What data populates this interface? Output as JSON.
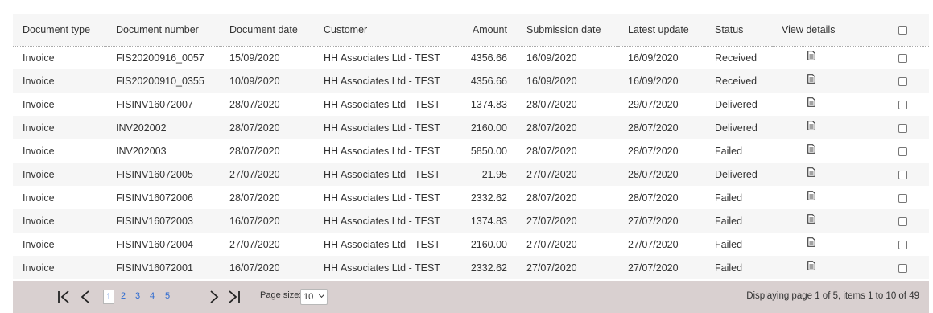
{
  "columns": [
    {
      "key": "type",
      "label": "Document type"
    },
    {
      "key": "number",
      "label": "Document number"
    },
    {
      "key": "date",
      "label": "Document date"
    },
    {
      "key": "customer",
      "label": "Customer"
    },
    {
      "key": "amount",
      "label": "Amount"
    },
    {
      "key": "submission",
      "label": "Submission date"
    },
    {
      "key": "update",
      "label": "Latest update"
    },
    {
      "key": "status",
      "label": "Status"
    },
    {
      "key": "details",
      "label": "View details"
    }
  ],
  "rows": [
    {
      "type": "Invoice",
      "number": "FIS20200916_0057",
      "date": "15/09/2020",
      "customer": "HH Associates Ltd - TEST",
      "amount": "4356.66",
      "submission": "16/09/2020",
      "update": "16/09/2020",
      "status": "Received"
    },
    {
      "type": "Invoice",
      "number": "FIS20200910_0355",
      "date": "10/09/2020",
      "customer": "HH Associates Ltd - TEST",
      "amount": "4356.66",
      "submission": "16/09/2020",
      "update": "16/09/2020",
      "status": "Received"
    },
    {
      "type": "Invoice",
      "number": "FISINV16072007",
      "date": "28/07/2020",
      "customer": "HH Associates Ltd - TEST",
      "amount": "1374.83",
      "submission": "28/07/2020",
      "update": "29/07/2020",
      "status": "Delivered"
    },
    {
      "type": "Invoice",
      "number": "INV202002",
      "date": "28/07/2020",
      "customer": "HH Associates Ltd - TEST",
      "amount": "2160.00",
      "submission": "28/07/2020",
      "update": "28/07/2020",
      "status": "Delivered"
    },
    {
      "type": "Invoice",
      "number": "INV202003",
      "date": "28/07/2020",
      "customer": "HH Associates Ltd - TEST",
      "amount": "5850.00",
      "submission": "28/07/2020",
      "update": "28/07/2020",
      "status": "Failed"
    },
    {
      "type": "Invoice",
      "number": "FISINV16072005",
      "date": "27/07/2020",
      "customer": "HH Associates Ltd - TEST",
      "amount": "21.95",
      "submission": "27/07/2020",
      "update": "28/07/2020",
      "status": "Delivered"
    },
    {
      "type": "Invoice",
      "number": "FISINV16072006",
      "date": "28/07/2020",
      "customer": "HH Associates Ltd - TEST",
      "amount": "2332.62",
      "submission": "28/07/2020",
      "update": "28/07/2020",
      "status": "Failed"
    },
    {
      "type": "Invoice",
      "number": "FISINV16072003",
      "date": "16/07/2020",
      "customer": "HH Associates Ltd - TEST",
      "amount": "1374.83",
      "submission": "27/07/2020",
      "update": "27/07/2020",
      "status": "Failed"
    },
    {
      "type": "Invoice",
      "number": "FISINV16072004",
      "date": "27/07/2020",
      "customer": "HH Associates Ltd - TEST",
      "amount": "2160.00",
      "submission": "27/07/2020",
      "update": "27/07/2020",
      "status": "Failed"
    },
    {
      "type": "Invoice",
      "number": "FISINV16072001",
      "date": "16/07/2020",
      "customer": "HH Associates Ltd - TEST",
      "amount": "2332.62",
      "submission": "27/07/2020",
      "update": "27/07/2020",
      "status": "Failed"
    }
  ],
  "details_icon": "document-icon",
  "pager": {
    "first_glyph": "|<",
    "prev_glyph": "<",
    "next_glyph": ">",
    "last_glyph": ">|",
    "pages": [
      "1",
      "2",
      "3",
      "4",
      "5"
    ],
    "current_page": "1",
    "page_size_label": "Page size:",
    "page_size_value": "10",
    "info": "Displaying page 1 of 5, items 1 to 10 of 49"
  },
  "colors": {
    "header_bg": "#f6f6f6",
    "stripe_bg": "#f6f6f6",
    "pager_bg": "#d9d0d0",
    "page_link": "#2d6ad0",
    "text": "#333333"
  }
}
